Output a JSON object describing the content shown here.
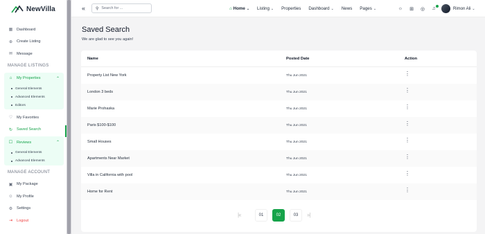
{
  "app": {
    "name": "NewVilla"
  },
  "sidebar": {
    "items": [
      {
        "label": "Dashboard",
        "icon": "dashboard-icon"
      },
      {
        "label": "Create Listing",
        "icon": "plus-circle-icon"
      },
      {
        "label": "Message",
        "icon": "message-icon"
      }
    ],
    "manage_listings_label": "MANAGE LISTINGS",
    "my_properties": {
      "label": "My Properties",
      "sub": [
        "General Elements",
        "Advanced Elements",
        "Editors"
      ]
    },
    "my_favorites": "My Favorites",
    "saved_search": "Saved Search",
    "reviews": {
      "label": "Reviews",
      "sub": [
        "General Elements",
        "Advanced Elements"
      ]
    },
    "manage_account_label": "MANAGE ACCOUNT",
    "account_items": [
      {
        "label": "My Package",
        "icon": "package-icon"
      },
      {
        "label": "My Profile",
        "icon": "user-icon"
      },
      {
        "label": "Settings",
        "icon": "gear-icon"
      },
      {
        "label": "Logout",
        "icon": "logout-icon"
      }
    ]
  },
  "header": {
    "search_placeholder": "Search for ...",
    "nav": [
      {
        "label": "Home",
        "caret": true
      },
      {
        "label": "Listing",
        "caret": true
      },
      {
        "label": "Properties",
        "caret": false
      },
      {
        "label": "Dashboard",
        "caret": true
      },
      {
        "label": "News",
        "caret": false
      },
      {
        "label": "Pages",
        "caret": true
      }
    ],
    "user_name": "Rimon Ali"
  },
  "main": {
    "title": "Saved Search",
    "subtitle": "We are glad to see you again!",
    "columns": {
      "name": "Name",
      "posted": "Posted Date",
      "action": "Action"
    },
    "rows": [
      {
        "name": "Property List New York",
        "date": "Thu Jun 2021"
      },
      {
        "name": "London 3 beds",
        "date": "Thu Jun 2021"
      },
      {
        "name": "Marie Prohaska",
        "date": "Thu Jun 2021"
      },
      {
        "name": "Paris $100-$100",
        "date": "Thu Jun 2021"
      },
      {
        "name": "Small Houses",
        "date": "Thu Jun 2021"
      },
      {
        "name": "Apartments Near Market",
        "date": "Thu Jun 2021"
      },
      {
        "name": "Villa in California with pool",
        "date": "Thu Jun 2021"
      },
      {
        "name": "Home for Rent",
        "date": "Thu Jun 2021"
      }
    ],
    "pagination": {
      "pages": [
        "01",
        "02",
        "03"
      ],
      "current": "02"
    }
  },
  "colors": {
    "accent": "#16a34a",
    "danger": "#ef4444"
  }
}
